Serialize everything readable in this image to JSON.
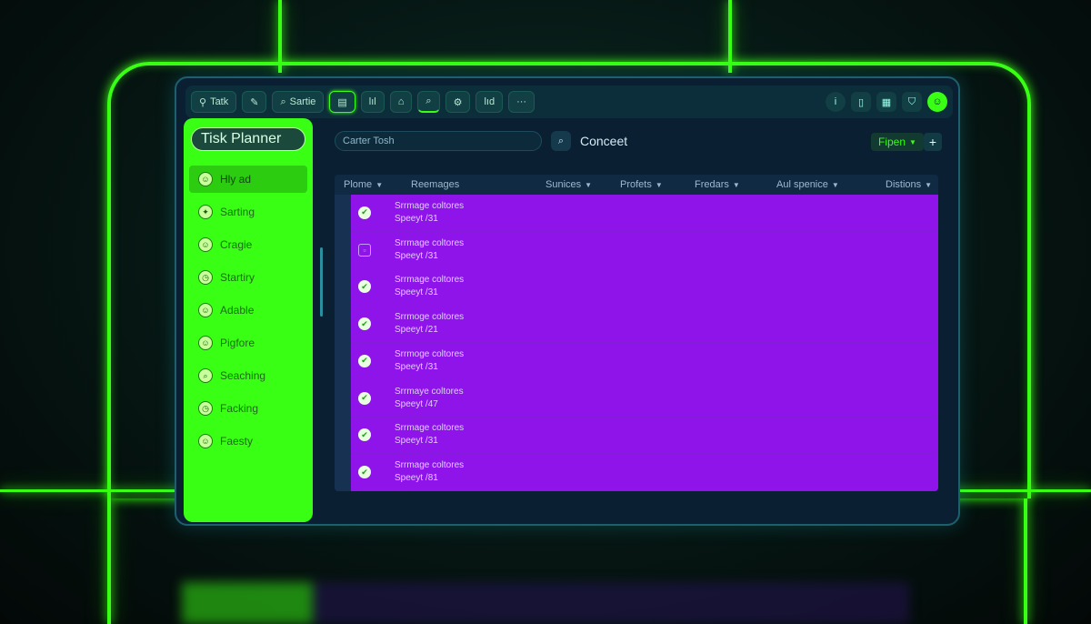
{
  "colors": {
    "accent": "#39ff14",
    "table_body": "#8e14ea",
    "window_bg": "#0a2032"
  },
  "toolbar": {
    "items": [
      {
        "icon": "tag-icon",
        "label": "Tatk"
      },
      {
        "icon": "pen-icon",
        "label": ""
      },
      {
        "icon": "search-icon",
        "label": "Sartie"
      },
      {
        "icon": "document-icon",
        "label": ""
      },
      {
        "icon": "chart-icon",
        "label": "lıl"
      },
      {
        "icon": "home-icon",
        "label": ""
      },
      {
        "icon": "magnifier-icon",
        "label": ""
      },
      {
        "icon": "gear-icon",
        "label": ""
      },
      {
        "icon": "grid-icon",
        "label": "lıd"
      },
      {
        "icon": "more-icon",
        "label": "···"
      }
    ],
    "right": [
      {
        "icon": "info-icon",
        "label": "i"
      },
      {
        "icon": "book-icon",
        "label": ""
      },
      {
        "icon": "calendar-icon",
        "label": ""
      },
      {
        "icon": "shield-icon",
        "label": ""
      },
      {
        "icon": "user-avatar-icon",
        "label": ""
      }
    ]
  },
  "sidebar": {
    "title": "Tisk Planner",
    "items": [
      {
        "label": "Hly ad",
        "icon": "avatar-icon",
        "active": true
      },
      {
        "label": "Sarting",
        "icon": "bulb-icon"
      },
      {
        "label": "Cragie",
        "icon": "avatar-icon"
      },
      {
        "label": "Startiry",
        "icon": "clock-icon"
      },
      {
        "label": "Adable",
        "icon": "avatar-icon"
      },
      {
        "label": "Pigfore",
        "icon": "avatar-icon"
      },
      {
        "label": "Seaching",
        "icon": "search-icon"
      },
      {
        "label": "Facking",
        "icon": "clock-icon"
      },
      {
        "label": "Faesty",
        "icon": "avatar-icon"
      }
    ]
  },
  "search": {
    "value": "Carter Tosh",
    "label": "Conceet"
  },
  "filter": {
    "label": "Fipen"
  },
  "table": {
    "columns": [
      "Plome",
      "Reemages",
      "Sunices",
      "Profets",
      "Fredars",
      "Aul spenice",
      "Distions"
    ],
    "rows": [
      {
        "status": "done",
        "line1": "Srrmage coltores",
        "line2": "Speeyt /31"
      },
      {
        "status": "pending",
        "line1": "Srrmage coltores",
        "line2": "Speeyt /31"
      },
      {
        "status": "done",
        "line1": "Srrmage coltores",
        "line2": "Speeyt /31"
      },
      {
        "status": "done",
        "line1": "Srrmoge coltores",
        "line2": "Speeyt /21"
      },
      {
        "status": "done",
        "line1": "Srrmoge coltores",
        "line2": "Speeyt /31"
      },
      {
        "status": "done",
        "line1": "Srrmaye coltores",
        "line2": "Speeyt /47"
      },
      {
        "status": "done",
        "line1": "Srrmage coltores",
        "line2": "Speeyt /31"
      },
      {
        "status": "done",
        "line1": "Srrmage coltores",
        "line2": "Speeyt /81"
      }
    ]
  }
}
